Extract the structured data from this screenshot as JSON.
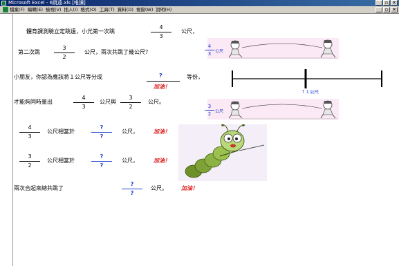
{
  "window": {
    "title": "Microsoft Excel - 6跳遠.xls [唯讀]",
    "buttons": [
      "_",
      "▫",
      "✕"
    ]
  },
  "menubar": {
    "items": [
      "檔案(F)",
      "編輯(E)",
      "檢視(V)",
      "插入(I)",
      "格式(O)",
      "工具(T)",
      "資料(D)",
      "視窗(W)",
      "說明(H)"
    ],
    "buttons": [
      "_",
      "▫",
      "✕"
    ]
  },
  "q1": {
    "line1": "體育課測驗立定跳遠，小光第一次跳",
    "frac1": {
      "num": "4",
      "den": "3"
    },
    "unit1": "公尺，",
    "line2_pre": "第二次跳",
    "frac2": {
      "num": "3",
      "den": "2"
    },
    "line2_post": "公尺，兩次共跳了幾公尺？"
  },
  "q2": {
    "text": "小朋友，你認為應該將１公尺等分成",
    "answer": "?",
    "post": "等份，",
    "cheer": "加油！",
    "line3_pre": "才能夠同時量出",
    "frac_a": {
      "num": "4",
      "den": "3"
    },
    "mid": "公尺與",
    "frac_b": {
      "num": "3",
      "den": "2"
    },
    "end": "公尺。"
  },
  "conv1": {
    "frac": {
      "num": "4",
      "den": "3"
    },
    "text": "公尺相當於",
    "ans": {
      "num": "?",
      "den": "?"
    },
    "unit": "公尺，",
    "cheer": "加油！"
  },
  "conv2": {
    "frac": {
      "num": "3",
      "den": "2"
    },
    "text": "公尺相當於",
    "ans": {
      "num": "?",
      "den": "?"
    },
    "unit": "公尺，",
    "cheer": "加油！"
  },
  "total": {
    "text": "兩次合起來總共跳了",
    "ans": {
      "num": "?",
      "den": "?"
    },
    "unit": "公尺。",
    "cheer": "加油！"
  },
  "jump1": {
    "frac": {
      "num": "4",
      "den": "3"
    },
    "unit": "公尺"
  },
  "jump2": {
    "frac": {
      "num": "3",
      "den": "2"
    },
    "unit": "公尺"
  },
  "ruler": {
    "label": "↑１公尺"
  }
}
